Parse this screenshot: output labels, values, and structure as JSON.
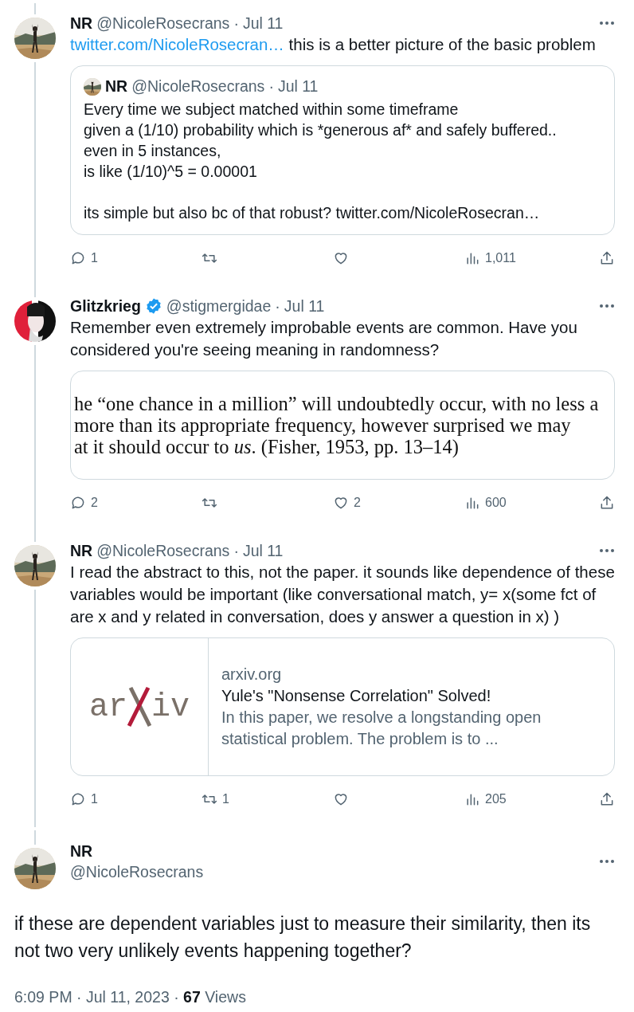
{
  "thread": [
    {
      "name": "NR",
      "verified": false,
      "handle": "@NicoleRosecrans",
      "separator": "·",
      "date": "Jul 11",
      "link": "twitter.com/NicoleRosecran…",
      "text": "this is a better picture of the basic problem",
      "attachment": {
        "kind": "quote",
        "name": "NR",
        "handle": "@NicoleRosecrans",
        "separator": "·",
        "date": "Jul 11",
        "text": "Every time we subject matched within some timeframe\ngiven a (1/10) probability which is *generous af* and safely buffered..\neven in 5 instances,\nis like (1/10)^5 = 0.00001\n\nits simple but also bc of that robust? twitter.com/NicoleRosecran…"
      },
      "actions": [
        {
          "kind": "reply",
          "count": "1"
        },
        {
          "kind": "repost"
        },
        {
          "kind": "like"
        },
        {
          "kind": "views",
          "count": "1,011"
        },
        {
          "kind": "share"
        }
      ]
    },
    {
      "avatar": {
        "kind": "artwork"
      },
      "name": "Glitzkrieg",
      "verified": true,
      "handle": "@stigmergidae",
      "separator": "·",
      "date": "Jul 11",
      "text": "Remember even extremely improbable events are common. Have you considered you're seeing meaning in randomness?",
      "attachment": {
        "kind": "document",
        "lines": [
          "he “one chance in a million” will undoubtedly occur, with no less a",
          "more than its appropriate frequency, however surprised we may",
          "at it should occur to *us*. (Fisher, 1953, pp. 13–14)"
        ]
      },
      "actions": [
        {
          "kind": "reply",
          "count": "2"
        },
        {
          "kind": "repost"
        },
        {
          "kind": "like",
          "count": "2"
        },
        {
          "kind": "views",
          "count": "600"
        },
        {
          "kind": "share"
        }
      ]
    },
    {
      "name": "NR",
      "verified": false,
      "handle": "@NicoleRosecrans",
      "separator": "·",
      "date": "Jul 11",
      "text": "I read the abstract to this, not the paper. it sounds like dependence of these variables would be important (like conversational match, y= x(some fct of are x and y related in conversation, does y answer a question in x) )",
      "attachment": {
        "kind": "link",
        "logo_left": "ar",
        "logo_right": "iv",
        "domain": "arxiv.org",
        "title": "Yule's \"Nonsense Correlation\" Solved!",
        "description": "In this paper, we resolve a longstanding open statistical problem. The problem is to ..."
      },
      "actions": [
        {
          "kind": "reply",
          "count": "1"
        },
        {
          "kind": "repost",
          "count": "1"
        },
        {
          "kind": "like"
        },
        {
          "kind": "views",
          "count": "205"
        },
        {
          "kind": "share"
        }
      ]
    }
  ],
  "main_tweet": {
    "name": "NR",
    "handle": "@NicoleRosecrans",
    "text": "if these are dependent variables just to measure their similarity, then its not two very unlikely events happening together?",
    "footer": "6:09 PM · Jul 11, 2023 · **67** Views"
  }
}
